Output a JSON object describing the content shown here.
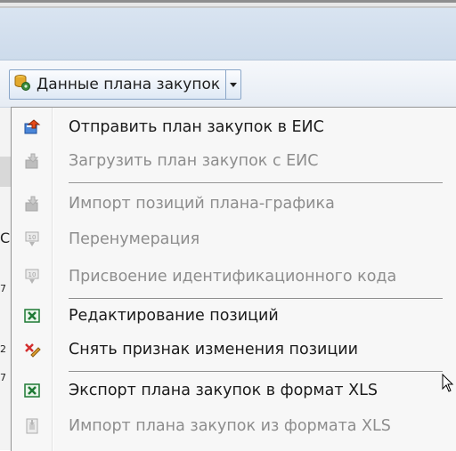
{
  "toolbar": {
    "plan_data_button": {
      "label": "Данные плана закупок",
      "icon": "database-gear-icon"
    },
    "dropdown_icon": "chevron-down-icon"
  },
  "background": {
    "left_fragments": [
      "С",
      "7",
      "2",
      "7"
    ]
  },
  "menu": {
    "items": [
      {
        "label": "Отправить план закупок в ЕИС",
        "icon": "send-upload-icon",
        "enabled": true
      },
      {
        "label": "Загрузить план закупок с ЕИС",
        "icon": "download-icon",
        "enabled": false
      },
      {
        "label": "Импорт позиций плана-графика",
        "icon": "import-icon",
        "enabled": false
      },
      {
        "label": "Перенумерация",
        "icon": "renumber-icon",
        "enabled": false
      },
      {
        "label": "Присвоение идентификационного кода",
        "icon": "assign-code-icon",
        "enabled": false
      },
      {
        "label": "Редактирование позиций",
        "icon": "excel-icon",
        "enabled": true
      },
      {
        "label": "Снять признак изменения позиции",
        "icon": "remove-mark-icon",
        "enabled": true
      },
      {
        "label": "Экспорт плана закупок в формат XLS",
        "icon": "excel-icon",
        "enabled": true
      },
      {
        "label": "Импорт плана закупок из формата XLS",
        "icon": "import-xls-icon",
        "enabled": false
      }
    ]
  },
  "colors": {
    "header_band": "#cddbeb",
    "menu_background": "#f7f7f7",
    "disabled_text": "#8d8d8d",
    "excel_green": "#1f7a35"
  }
}
